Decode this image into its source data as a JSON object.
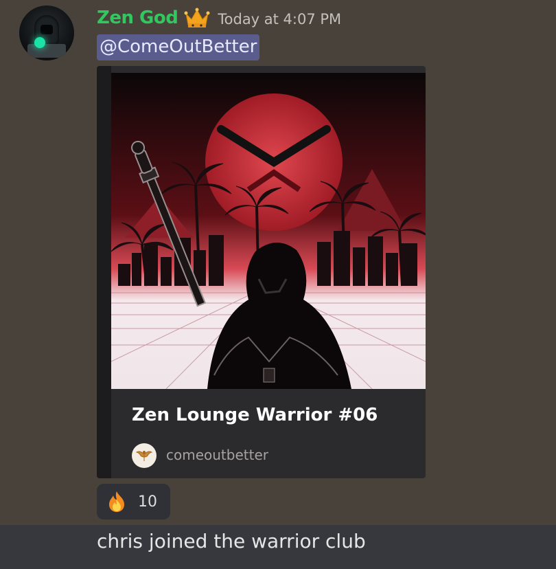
{
  "message": {
    "username": "Zen God",
    "username_color": "#32c860",
    "badge_icon": "crown-icon",
    "timestamp": "Today at 4:07 PM",
    "mention": "@ComeOutBetter"
  },
  "embed": {
    "image_icon": "nft-warrior-artwork",
    "title": "Zen Lounge Warrior #06",
    "provider_icon": "phoenix-logo-icon",
    "provider": "comeoutbetter"
  },
  "reaction": {
    "emoji_icon": "fire-icon",
    "count": "10"
  },
  "next_message": {
    "text": "chris joined the warrior club"
  },
  "colors": {
    "background": "#48423a",
    "mention_bg": "#5b5c8e",
    "embed_bg": "#2b2b2d"
  }
}
